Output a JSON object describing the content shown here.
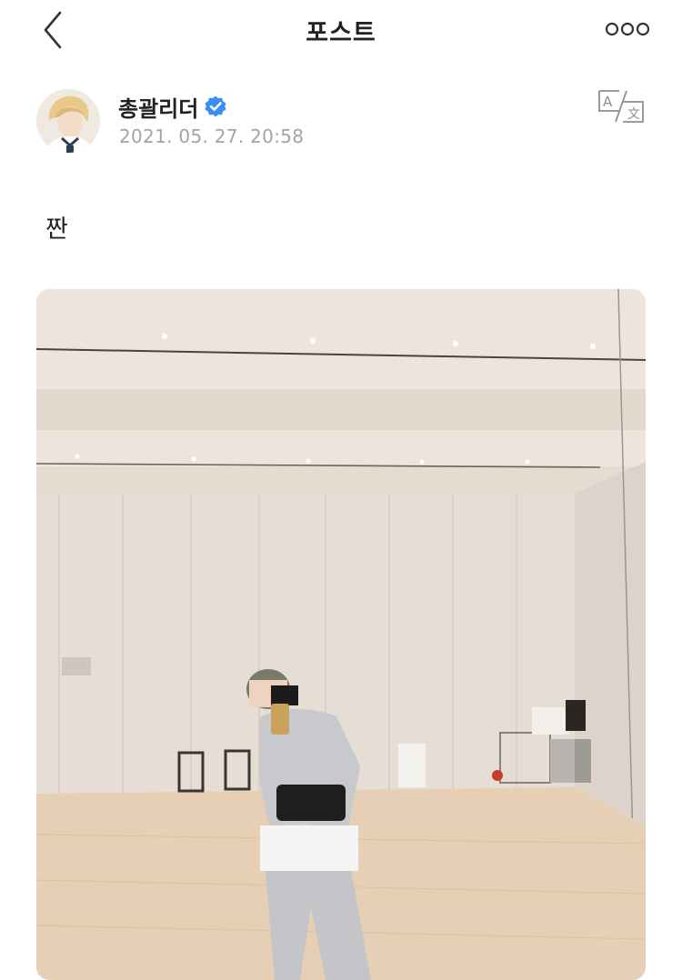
{
  "header": {
    "title": "포스트",
    "back_icon": "chevron-left-icon",
    "more_icon": "more-horizontal-icon"
  },
  "post": {
    "author_name": "총괄리더",
    "verified_icon": "verified-badge-icon",
    "timestamp": "2021. 05. 27. 20:58",
    "translate_icon": "translate-icon",
    "text": "짠"
  },
  "colors": {
    "verified_badge": "#3b8ef3",
    "timestamp": "#a3a3a8",
    "icon_gray": "#8e8e93"
  }
}
